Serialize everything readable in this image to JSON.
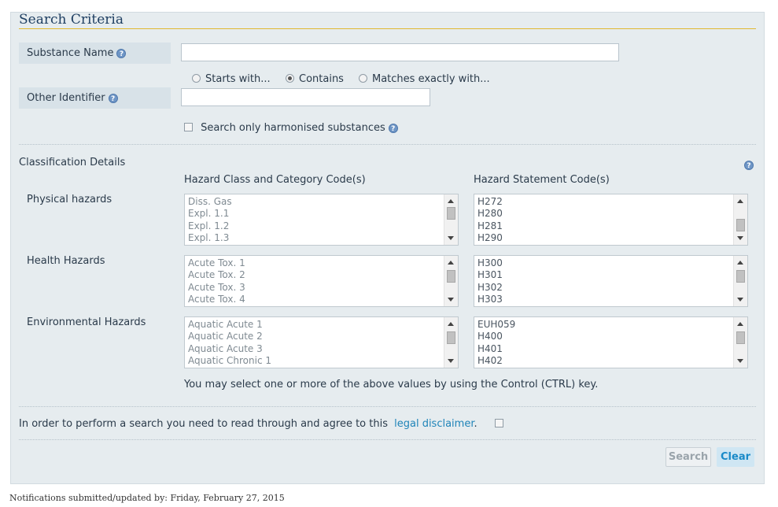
{
  "title": "Search Criteria",
  "substance_name": {
    "label": "Substance Name",
    "value": ""
  },
  "match_options": [
    {
      "label": "Starts with...",
      "selected": false
    },
    {
      "label": "Contains",
      "selected": true
    },
    {
      "label": "Matches exactly with...",
      "selected": false
    }
  ],
  "other_identifier": {
    "label": "Other Identifier",
    "value": ""
  },
  "harmonised": {
    "label": "Search only harmonised substances",
    "checked": false
  },
  "classification": {
    "section_label": "Classification Details",
    "col1_header": "Hazard Class and Category Code(s)",
    "col2_header": "Hazard Statement Code(s)",
    "rows": [
      {
        "label": "Physical hazards",
        "classes": [
          "Diss. Gas",
          "Expl. 1.1",
          "Expl. 1.2",
          "Expl. 1.3"
        ],
        "statements": [
          "H272",
          "H280",
          "H281",
          "H290"
        ]
      },
      {
        "label": "Health Hazards",
        "classes": [
          "Acute Tox. 1",
          "Acute Tox. 2",
          "Acute Tox. 3",
          "Acute Tox. 4"
        ],
        "statements": [
          "H300",
          "H301",
          "H302",
          "H303"
        ]
      },
      {
        "label": "Environmental Hazards",
        "classes": [
          "Aquatic Acute 1",
          "Aquatic Acute 2",
          "Aquatic Acute 3",
          "Aquatic Chronic 1"
        ],
        "statements": [
          "EUH059",
          "H400",
          "H401",
          "H402"
        ]
      }
    ],
    "hint": "You may select one or more of the above values by using the Control (CTRL) key."
  },
  "disclaimer": {
    "text": "In order to perform a search you need to read through and agree to this",
    "link": "legal disclaimer",
    "tail": ".",
    "checked": false
  },
  "buttons": {
    "search": "Search",
    "clear": "Clear"
  },
  "footer": "Notifications submitted/updated by: Friday, February 27, 2015"
}
